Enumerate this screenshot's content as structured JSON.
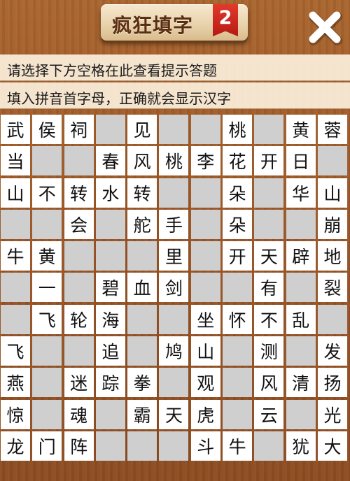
{
  "header": {
    "title": "疯狂填字",
    "badge": "2",
    "close_icon": "close-icon"
  },
  "hints": [
    "请选择下方空格在此查看提示答题",
    "填入拼音首字母，正确就会显示汉字"
  ],
  "colors": {
    "cell_filled": "#ffffff",
    "cell_empty": "#cfcfcf",
    "badge": "#d22a20",
    "wood": "#9a5626"
  },
  "grid": [
    [
      "武",
      "侯",
      "祠",
      "",
      "见",
      "",
      "",
      "桃",
      "",
      "黄",
      "蓉"
    ],
    [
      "当",
      "",
      "",
      "春",
      "风",
      "桃",
      "李",
      "花",
      "开",
      "日",
      ""
    ],
    [
      "山",
      "不",
      "转",
      "水",
      "转",
      "",
      "",
      "朵",
      "",
      "华",
      "山"
    ],
    [
      "",
      "",
      "会",
      "",
      "舵",
      "手",
      "",
      "朵",
      "",
      "",
      "崩"
    ],
    [
      "牛",
      "黄",
      "",
      "",
      "",
      "里",
      "",
      "开",
      "天",
      "辟",
      "地"
    ],
    [
      "",
      "一",
      "",
      "碧",
      "血",
      "剑",
      "",
      "",
      "有",
      "",
      "裂"
    ],
    [
      "",
      "飞",
      "轮",
      "海",
      "",
      "",
      "坐",
      "怀",
      "不",
      "乱",
      ""
    ],
    [
      "飞",
      "",
      "",
      "追",
      "",
      "鸠",
      "山",
      "",
      "测",
      "",
      "发"
    ],
    [
      "燕",
      "",
      "迷",
      "踪",
      "拳",
      "",
      "观",
      "",
      "风",
      "清",
      "扬"
    ],
    [
      "惊",
      "",
      "魂",
      "",
      "霸",
      "天",
      "虎",
      "",
      "云",
      "",
      "光"
    ],
    [
      "龙",
      "门",
      "阵",
      "",
      "",
      "",
      "斗",
      "牛",
      "",
      "犹",
      "大"
    ]
  ]
}
